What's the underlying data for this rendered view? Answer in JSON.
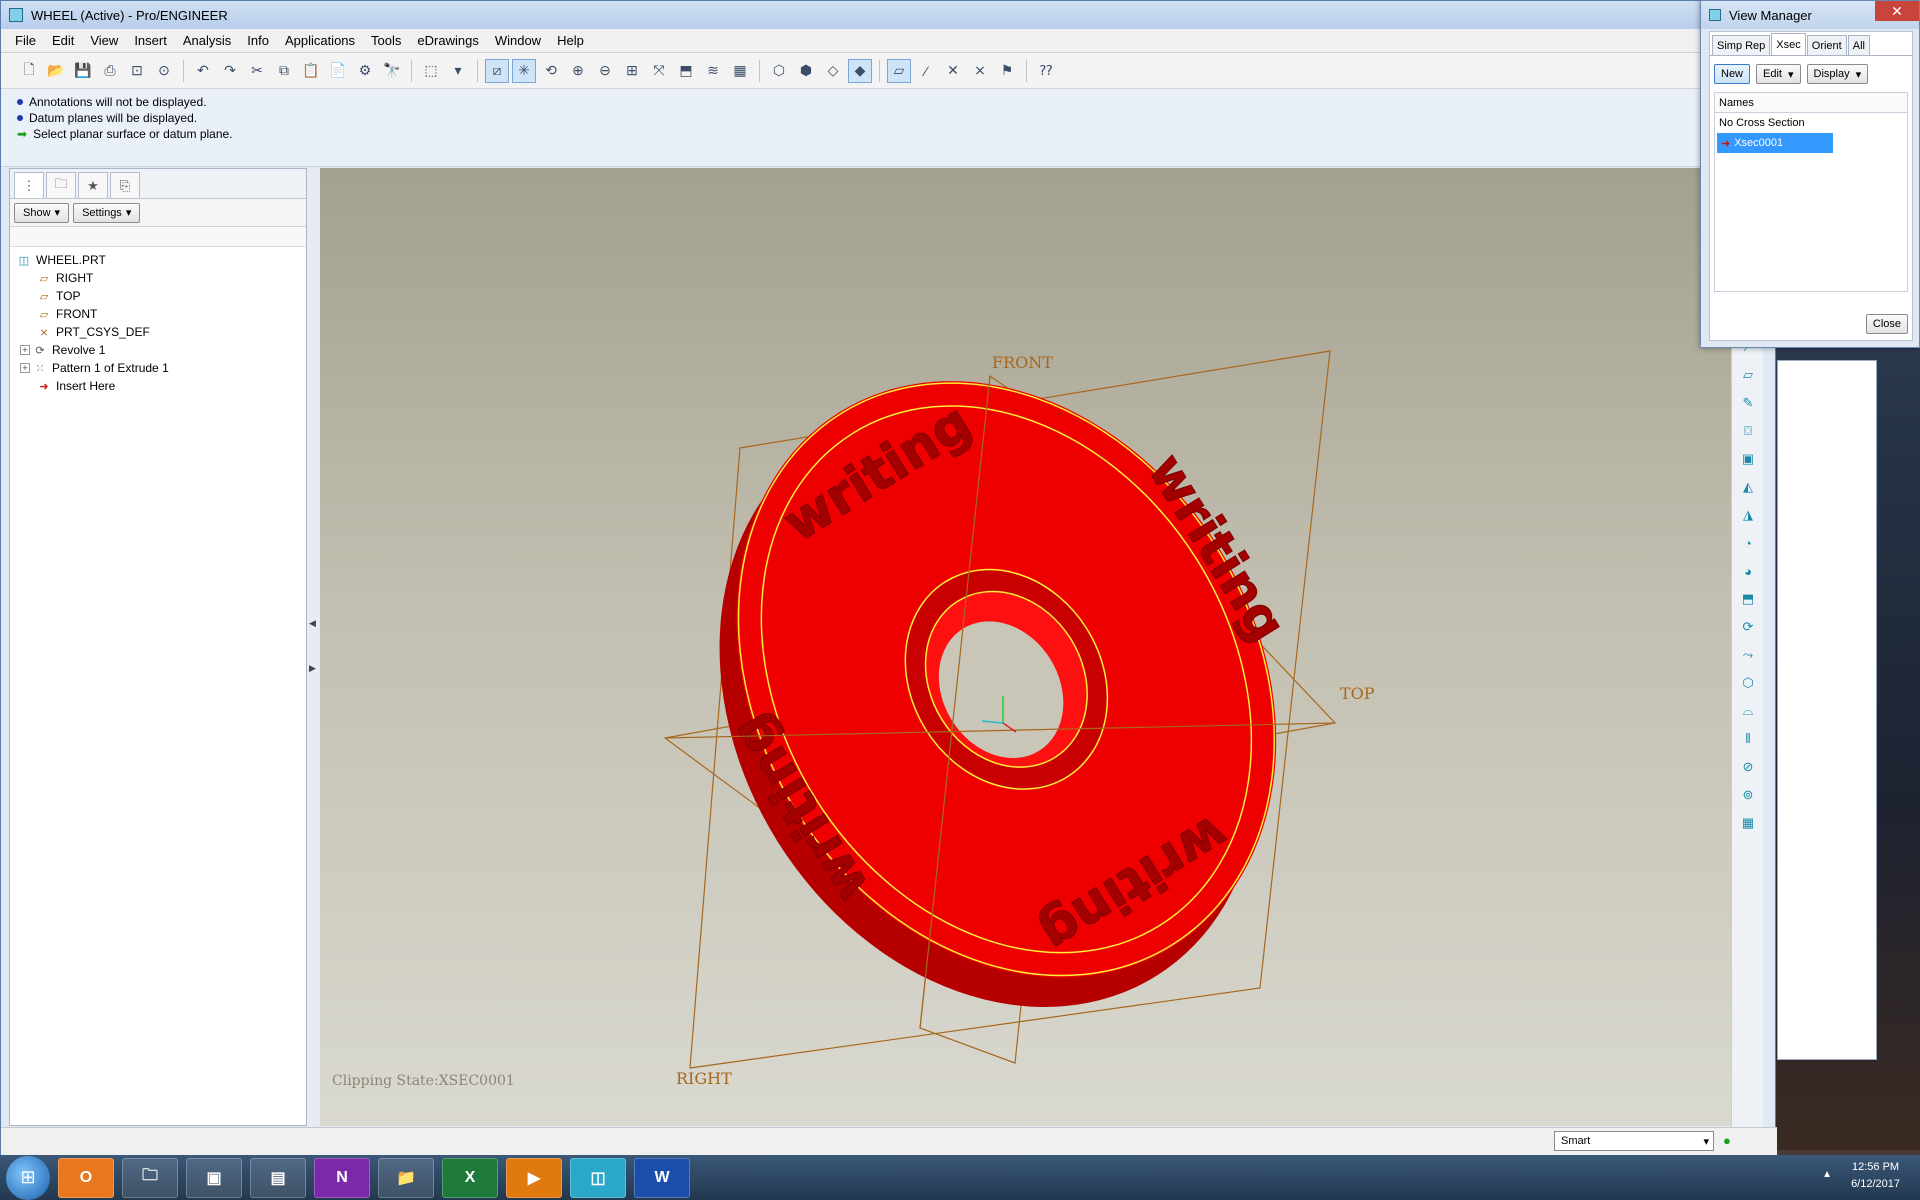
{
  "window": {
    "title": "WHEEL (Active) - Pro/ENGINEER"
  },
  "menu": [
    "File",
    "Edit",
    "View",
    "Insert",
    "Analysis",
    "Info",
    "Applications",
    "Tools",
    "eDrawings",
    "Window",
    "Help"
  ],
  "messages": [
    {
      "kind": "info",
      "text": "Annotations will not be displayed."
    },
    {
      "kind": "info",
      "text": "Datum planes will be displayed."
    },
    {
      "kind": "prompt",
      "text": "Select planar surface or datum plane."
    }
  ],
  "left_panel": {
    "show_label": "Show",
    "settings_label": "Settings",
    "tree": [
      {
        "label": "WHEEL.PRT",
        "icon": "part-icon",
        "indent": 0,
        "expand": false
      },
      {
        "label": "RIGHT",
        "icon": "datum-plane-icon",
        "indent": 1,
        "expand": false
      },
      {
        "label": "TOP",
        "icon": "datum-plane-icon",
        "indent": 1,
        "expand": false
      },
      {
        "label": "FRONT",
        "icon": "datum-plane-icon",
        "indent": 1,
        "expand": false
      },
      {
        "label": "PRT_CSYS_DEF",
        "icon": "csys-icon",
        "indent": 1,
        "expand": false
      },
      {
        "label": "Revolve 1",
        "icon": "revolve-icon",
        "indent": 1,
        "expand": true
      },
      {
        "label": "Pattern 1 of Extrude 1",
        "icon": "pattern-icon",
        "indent": 1,
        "expand": true
      },
      {
        "label": "Insert Here",
        "icon": "insert-arrow-icon",
        "indent": 1,
        "expand": false
      }
    ]
  },
  "graphics": {
    "clipping_state": "Clipping State:XSEC0001",
    "datum_labels": {
      "front": "FRONT",
      "top": "TOP",
      "right": "RIGHT"
    },
    "emboss_text": "writing",
    "colors": {
      "part": "#ee0000",
      "datum": "#a7681e",
      "edge": "#ffee33"
    }
  },
  "status": {
    "filter": "Smart"
  },
  "view_manager": {
    "title": "View Manager",
    "tabs": [
      "Simp Rep",
      "Xsec",
      "Orient",
      "All"
    ],
    "active_tab": "Xsec",
    "buttons": {
      "new": "New",
      "edit": "Edit",
      "display": "Display",
      "close": "Close"
    },
    "list_header": "Names",
    "items": [
      "No Cross Section",
      "Xsec0001"
    ],
    "selected": "Xsec0001"
  },
  "taskbar": {
    "time": "12:56 PM",
    "date": "6/12/2017"
  }
}
